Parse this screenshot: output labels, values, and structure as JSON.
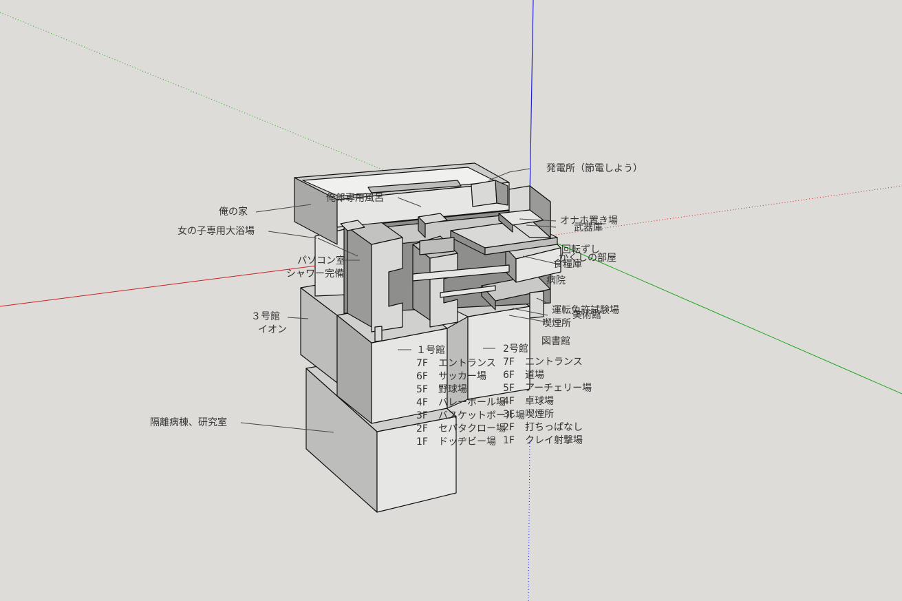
{
  "colors": {
    "background": "#dddcd8",
    "axis_red": "#cc1f1f",
    "axis_green": "#1aa51a",
    "axis_blue": "#1f1fd0",
    "model_face_light": "#e6e6e4",
    "model_face_mid": "#bdbdbb",
    "model_face_dark": "#8e8e8c",
    "edge": "#111111",
    "label_text": "#333333"
  },
  "labels": {
    "ore_no_ie": "俺の家",
    "onnanoko_yokujo": "女の子専用大浴場",
    "jiro_furo": "俺郎専用風呂",
    "hatsudensho": "発電所（節電しよう）",
    "pasokon": "パソコン室",
    "shower": "シャワー完備",
    "gou3": "３号館",
    "aeon": "イオン",
    "kakuri": "隔離病棟、研究室",
    "onaho": "オナホ置き場",
    "bukiko": "武器庫",
    "kaiten": "回転ずし",
    "kakushi": "かくしの部屋",
    "sho": "食糧庫",
    "byoin": "病院",
    "untenmenkyo": "運転免許試験場",
    "bijutsukan": "美術館",
    "kitsuen": "喫煙所",
    "toshokan": "図書館"
  },
  "building1": {
    "title": "１号館",
    "floors": [
      {
        "floor": "7F",
        "name": "エントランス"
      },
      {
        "floor": "6F",
        "name": "サッカー場"
      },
      {
        "floor": "5F",
        "name": "野球場"
      },
      {
        "floor": "4F",
        "name": "バレーボール場"
      },
      {
        "floor": "3F",
        "name": "バスケットボール場"
      },
      {
        "floor": "2F",
        "name": "セパタクロー場"
      },
      {
        "floor": "1F",
        "name": "ドッヂビー場"
      }
    ]
  },
  "building2": {
    "title": "2号館",
    "floors": [
      {
        "floor": "7F",
        "name": "エントランス"
      },
      {
        "floor": "6F",
        "name": "道場"
      },
      {
        "floor": "5F",
        "name": "アーチェリー場"
      },
      {
        "floor": "4F",
        "name": "卓球場"
      },
      {
        "floor": "3F",
        "name": "喫煙所"
      },
      {
        "floor": "2F",
        "name": "打ちっぱなし"
      },
      {
        "floor": "1F",
        "name": "クレイ射撃場"
      }
    ]
  }
}
